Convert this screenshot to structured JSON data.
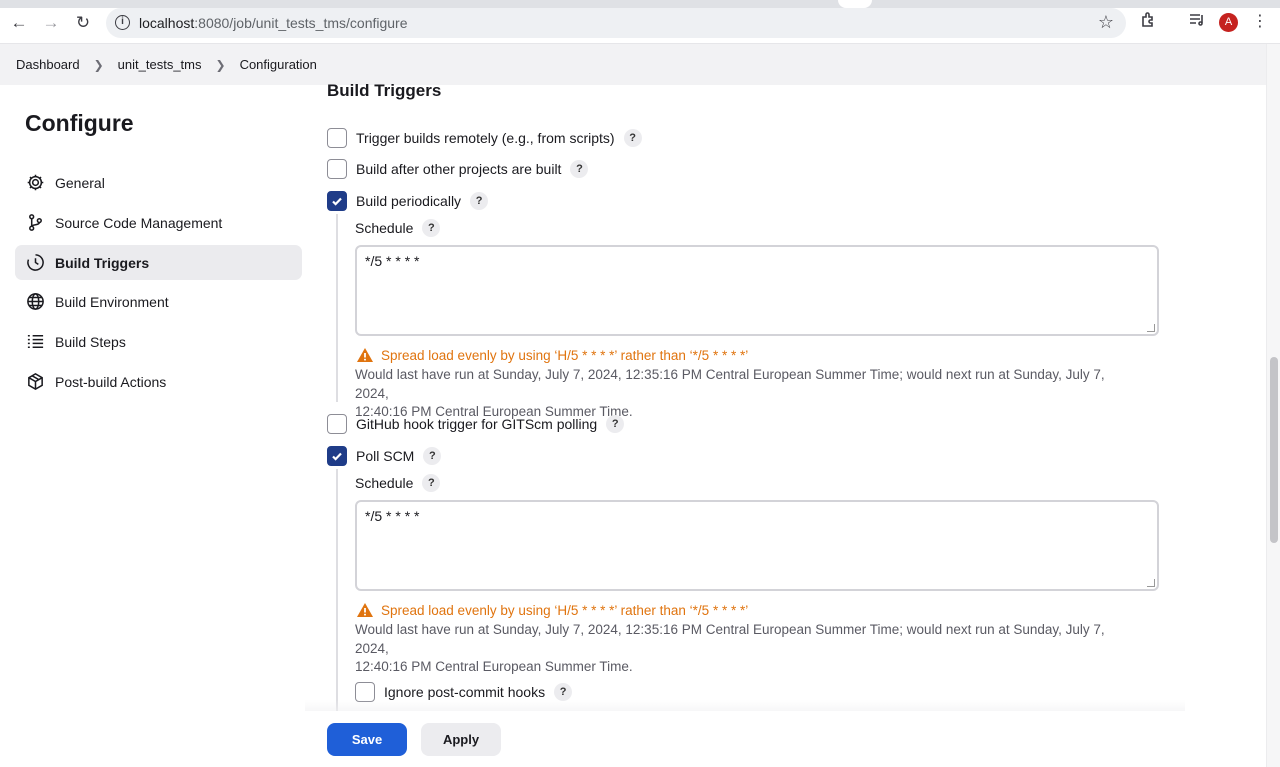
{
  "browser": {
    "url_host": "localhost",
    "url_rest": ":8080/job/unit_tests_tms/configure",
    "avatar_letter": "A"
  },
  "breadcrumb": [
    "Dashboard",
    "unit_tests_tms",
    "Configuration"
  ],
  "sidebar": {
    "title": "Configure",
    "items": [
      {
        "label": "General",
        "icon": "gear-icon",
        "active": false
      },
      {
        "label": "Source Code Management",
        "icon": "branch-icon",
        "active": false
      },
      {
        "label": "Build Triggers",
        "icon": "clock-icon",
        "active": true
      },
      {
        "label": "Build Environment",
        "icon": "globe-icon",
        "active": false
      },
      {
        "label": "Build Steps",
        "icon": "list-icon",
        "active": false
      },
      {
        "label": "Post-build Actions",
        "icon": "package-icon",
        "active": false
      }
    ]
  },
  "main": {
    "section_title": "Build Triggers",
    "triggers": [
      {
        "label": "Trigger builds remotely (e.g., from scripts)",
        "checked": false
      },
      {
        "label": "Build after other projects are built",
        "checked": false
      },
      {
        "label": "Build periodically",
        "checked": true
      },
      {
        "label": "GitHub hook trigger for GITScm polling",
        "checked": false
      },
      {
        "label": "Poll SCM",
        "checked": true
      }
    ],
    "schedule_label": "Schedule",
    "periodic_schedule": "*/5 * * * *",
    "poll_schedule": "*/5 * * * *",
    "warning": "Spread load evenly by using ‘H/5 * * * *’ rather than ‘*/5 * * * *’",
    "note_line1": "Would last have run at Sunday, July 7, 2024, 12:35:16 PM Central European Summer Time; would next run at Sunday, July 7, 2024,",
    "note_line2": "12:40:16 PM Central European Summer Time.",
    "ignore_hooks_label": "Ignore post-commit hooks",
    "help": "?"
  },
  "actions": {
    "save": "Save",
    "apply": "Apply"
  },
  "colors": {
    "accent": "#1f5fd8",
    "checkbox_checked": "#1f3c88",
    "warning": "#e0740f"
  }
}
